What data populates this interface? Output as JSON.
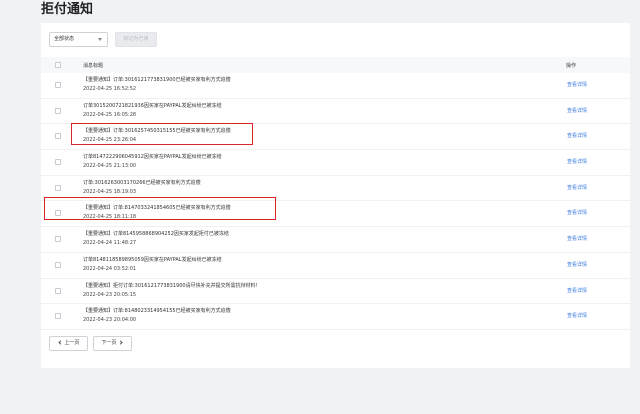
{
  "page": {
    "title": "拒付通知"
  },
  "toolbar": {
    "status_select_value": "全部状态",
    "mark_read_label": "标记为已读"
  },
  "table": {
    "header_title": "消息标题",
    "header_op": "操作",
    "detail_label": "查看详情",
    "rows": [
      {
        "msg": "【重要通知】订单:3016121773831900已经被买家有利方式追偿",
        "time": "2022-04-25 16:52:52"
      },
      {
        "msg": "订单3015200721821936因买家在PAYPAL发起纠纷已被冻结",
        "time": "2022-04-25 16:05:28"
      },
      {
        "msg": "【重要通知】订单:3016257450315155已经被买家有利方式追偿",
        "time": "2022-04-25 23:26:04"
      },
      {
        "msg": "订单8147222906045912因买家在PAYPAL发起纠纷已被冻结",
        "time": "2022-04-25 21:13:00"
      },
      {
        "msg": "订单:3016263003170266已经被买家有利方式追偿",
        "time": "2022-04-25 18:19:03"
      },
      {
        "msg": "【重要通知】订单:8147033241854605已经被买家有利方式追偿",
        "time": "2022-04-25 18:11:18"
      },
      {
        "msg": "【重要通知】订单8145958868904252因买家发起拒付已被冻结",
        "time": "2022-04-24 11:48:27"
      },
      {
        "msg": "订单8148118589895059因买家在PAYPAL发起纠纷已被冻结",
        "time": "2022-04-24 03:52:01"
      },
      {
        "msg": "【重要通知】拒付订单:3016121773831900请尽快补充并提交所需抗辩材料!",
        "time": "2022-04-23 20:05:15"
      },
      {
        "msg": "【重要通知】订单:8148023314954155已经被买家有利方式追偿",
        "time": "2022-04-23 20:04:00"
      }
    ]
  },
  "pager": {
    "prev_label": "上一页",
    "next_label": "下一页"
  },
  "colors": {
    "highlight": "#d9262b",
    "link": "#3a7be0"
  }
}
